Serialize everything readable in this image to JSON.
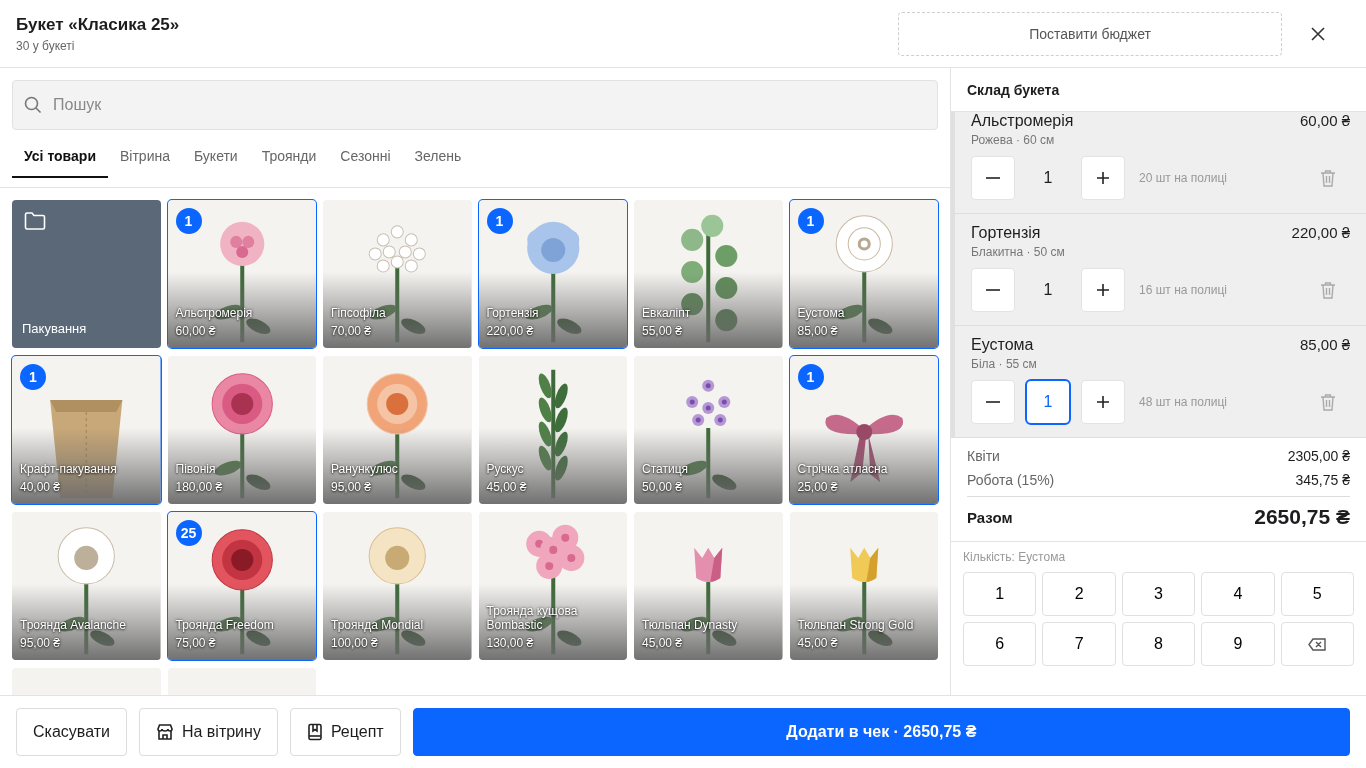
{
  "header": {
    "title": "Букет «Класика 25»",
    "subtitle": "30 у букеті",
    "budget_button": "Поставити бюджет"
  },
  "search": {
    "placeholder": "Пошук"
  },
  "tabs": [
    {
      "label": "Усі товари",
      "selected": true
    },
    {
      "label": "Вітрина",
      "selected": false
    },
    {
      "label": "Букети",
      "selected": false
    },
    {
      "label": "Троянди",
      "selected": false
    },
    {
      "label": "Сезонні",
      "selected": false
    },
    {
      "label": "Зелень",
      "selected": false
    }
  ],
  "tiles": [
    {
      "kind": "folder",
      "name": "Пакування"
    },
    {
      "kind": "product",
      "name": "Альстромерія",
      "price": "60,00 ₴",
      "badge": "1",
      "selected": true
    },
    {
      "kind": "product",
      "name": "Гіпсофіла",
      "price": "70,00 ₴",
      "selected": false
    },
    {
      "kind": "product",
      "name": "Гортензія",
      "price": "220,00 ₴",
      "badge": "1",
      "selected": true
    },
    {
      "kind": "product",
      "name": "Евкаліпт",
      "price": "55,00 ₴",
      "selected": false
    },
    {
      "kind": "product",
      "name": "Еустома",
      "price": "85,00 ₴",
      "badge": "1",
      "selected": true
    },
    {
      "kind": "product",
      "name": "Крафт-пакування",
      "price": "40,00 ₴",
      "badge": "1",
      "selected": true
    },
    {
      "kind": "product",
      "name": "Півонія",
      "price": "180,00 ₴",
      "selected": false
    },
    {
      "kind": "product",
      "name": "Ранункулюс",
      "price": "95,00 ₴",
      "selected": false
    },
    {
      "kind": "product",
      "name": "Рускус",
      "price": "45,00 ₴",
      "selected": false
    },
    {
      "kind": "product",
      "name": "Статиця",
      "price": "50,00 ₴",
      "selected": false
    },
    {
      "kind": "product",
      "name": "Стрічка атласна",
      "price": "25,00 ₴",
      "badge": "1",
      "selected": true
    },
    {
      "kind": "product",
      "name": "Троянда Avalanche",
      "price": "95,00 ₴",
      "selected": false
    },
    {
      "kind": "product",
      "name": "Троянда Freedom",
      "price": "75,00 ₴",
      "badge": "25",
      "selected": true
    },
    {
      "kind": "product",
      "name": "Троянда Mondial",
      "price": "100,00 ₴",
      "selected": false
    },
    {
      "kind": "product",
      "name": "Троянда кущова Bombastic",
      "price": "130,00 ₴",
      "selected": false
    },
    {
      "kind": "product",
      "name": "Тюльпан Dynasty",
      "price": "45,00 ₴",
      "selected": false
    },
    {
      "kind": "product",
      "name": "Тюльпан Strong Gold",
      "price": "45,00 ₴",
      "selected": false
    },
    {
      "kind": "cut"
    },
    {
      "kind": "cut"
    }
  ],
  "composition": {
    "title": "Склад букета",
    "items": [
      {
        "name": "Альстромерія",
        "price": "60,00 ₴",
        "details": "Рожева · 60 см",
        "quantity": "1",
        "stock": "20 шт на полиці",
        "selected": false
      },
      {
        "name": "Гортензія",
        "price": "220,00 ₴",
        "details": "Блакитна · 50 см",
        "quantity": "1",
        "stock": "16 шт на полиці",
        "selected": false
      },
      {
        "name": "Еустома",
        "price": "85,00 ₴",
        "details": "Біла · 55 см",
        "quantity": "1",
        "stock": "48 шт на полиці",
        "selected": true
      }
    ]
  },
  "totals": {
    "rows": [
      {
        "label": "Квіти",
        "value": "2305,00 ₴"
      },
      {
        "label": "Робота (15%)",
        "value": "345,75 ₴"
      }
    ],
    "total_label": "Разом",
    "total_value": "2650,75 ₴"
  },
  "keypad": {
    "label": "Кількість: Еустома",
    "keys": [
      {
        "kind": "digit",
        "label": "1"
      },
      {
        "kind": "digit",
        "label": "2"
      },
      {
        "kind": "digit",
        "label": "3"
      },
      {
        "kind": "digit",
        "label": "4"
      },
      {
        "kind": "digit",
        "label": "5"
      },
      {
        "kind": "digit",
        "label": "6"
      },
      {
        "kind": "digit",
        "label": "7"
      },
      {
        "kind": "digit",
        "label": "8"
      },
      {
        "kind": "digit",
        "label": "9"
      },
      {
        "kind": "backspace"
      }
    ]
  },
  "footer": {
    "buttons": [
      {
        "kind": "plain",
        "label": "Скасувати"
      },
      {
        "kind": "store",
        "label": "На вітрину"
      },
      {
        "kind": "recipe",
        "label": "Рецепт"
      },
      {
        "kind": "primary",
        "label": "Додати в чек · 2650,75 ₴"
      }
    ]
  }
}
